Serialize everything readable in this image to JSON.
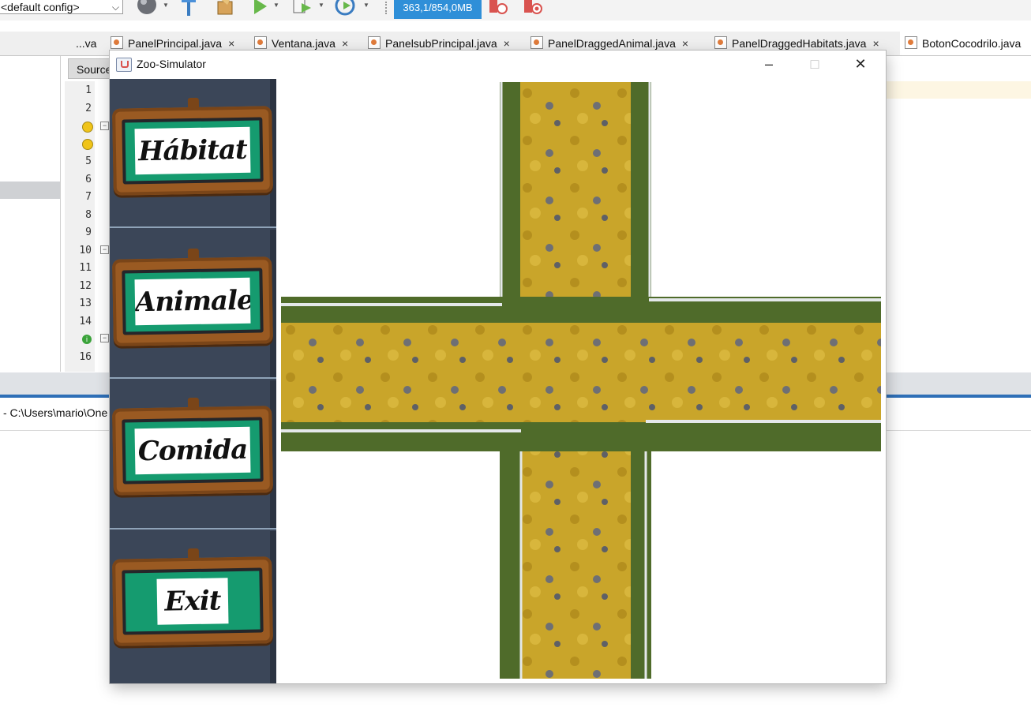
{
  "ide": {
    "config_select": "<default config>",
    "memory": "363,1/854,0MB",
    "projects_minimize": "_",
    "tabs": [
      {
        "label": "...va"
      },
      {
        "label": "PanelPrincipal.java",
        "close": "×"
      },
      {
        "label": "Ventana.java",
        "close": "×"
      },
      {
        "label": "PanelsubPrincipal.java",
        "close": "×"
      },
      {
        "label": "PanelDraggedAnimal.java",
        "close": "×"
      },
      {
        "label": "PanelDraggedHabitats.java",
        "close": "×"
      },
      {
        "label": "BotonCocodrilo.java"
      }
    ],
    "editor": {
      "source_tab": "Source",
      "line_numbers": [
        "1",
        "2",
        "",
        "",
        "5",
        "6",
        "7",
        "8",
        "9",
        "10",
        "11",
        "12",
        "13",
        "14",
        "",
        "16"
      ]
    },
    "output_path": "- C:\\Users\\mario\\One"
  },
  "window": {
    "title": "Zoo-Simulator",
    "controls": {
      "minimize": "–",
      "maximize": "□",
      "close": "✕"
    },
    "sidebar": [
      {
        "label": "Hábitat"
      },
      {
        "label": "Animales"
      },
      {
        "label": "Comida"
      },
      {
        "label": "Exit"
      }
    ],
    "colors": {
      "sidebar_bg": "#3b4658",
      "sign_wood": "#9a5a22",
      "sign_green": "#159b6f",
      "path_yellow": "#c9a52a",
      "grass": "#4f6b2a"
    }
  },
  "icons": [
    "globe-icon",
    "hammer-icon",
    "clean-build-icon",
    "run-icon",
    "debug-icon",
    "profile-icon",
    "gc-icon",
    "gc-stop-icon",
    "java-icon",
    "warning-bulb-icon",
    "implements-icon"
  ]
}
